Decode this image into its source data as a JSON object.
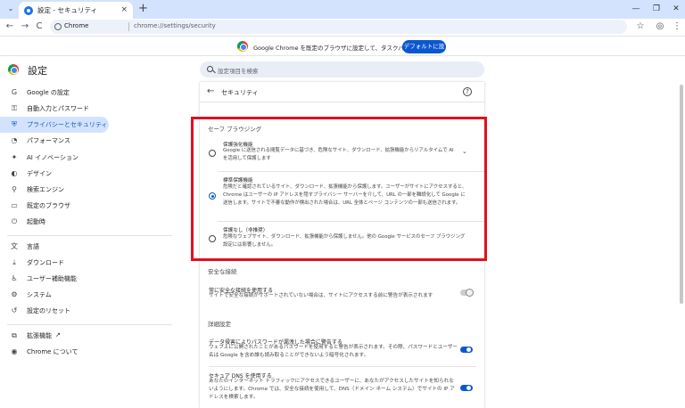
{
  "browser": {
    "tab_title": "設定 - セキュリティ",
    "tab_close": "×",
    "new_tab": "+",
    "tab_search": "⌄",
    "window_controls": {
      "minimize": "—",
      "restore": "❐",
      "close": "✕"
    },
    "nav": {
      "back": "←",
      "forward": "→",
      "reload": "C"
    },
    "omnibox": {
      "chip": "Chrome",
      "url": "chrome://settings/security"
    },
    "bookmark_star": "☆",
    "profile": "◎",
    "menu": "⋮"
  },
  "infobar": {
    "message": "Google Chrome を既定のブラウザに設定して、タスクバーに固定する",
    "button": "デフォルトに設定"
  },
  "settings_header": {
    "title": "設定",
    "search_placeholder": "設定項目を検索"
  },
  "sidebar": {
    "items": [
      {
        "label": "Google の設定",
        "icon": "G"
      },
      {
        "label": "自動入力とパスワード",
        "icon": "⚿"
      },
      {
        "label": "プライバシーとセキュリティ",
        "icon": "⛨"
      },
      {
        "label": "パフォーマンス",
        "icon": "◔"
      },
      {
        "label": "AI イノベーション",
        "icon": "✦"
      },
      {
        "label": "デザイン",
        "icon": "◐"
      },
      {
        "label": "検索エンジン",
        "icon": "⚲"
      },
      {
        "label": "既定のブラウザ",
        "icon": "▭"
      },
      {
        "label": "起動時",
        "icon": "⏻"
      },
      {
        "label": "言語",
        "icon": "文"
      },
      {
        "label": "ダウンロード",
        "icon": "⤓"
      },
      {
        "label": "ユーザー補助機能",
        "icon": "♿"
      },
      {
        "label": "システム",
        "icon": "⚙"
      },
      {
        "label": "設定のリセット",
        "icon": "↺"
      },
      {
        "label": "拡張機能",
        "icon": "⧉",
        "external": "↗"
      },
      {
        "label": "Chrome について",
        "icon": "◉"
      }
    ]
  },
  "panel": {
    "back": "←",
    "title": "セキュリティ",
    "help": "?",
    "safe_browsing_heading": "セーフ ブラウジング",
    "options": [
      {
        "title": "保護強化機能",
        "desc": "Google に送信される閲覧データに基づき、危険なサイト、ダウンロード、拡張機能からリアルタイムで AI を活用して保護します",
        "checked": false,
        "expand": "⌄"
      },
      {
        "title": "標準保護機能",
        "desc": "危険だと確認されているサイト、ダウンロード、拡張機能から保護します。ユーザーがサイトにアクセスすると、Chrome はユーザーの IP アドレスを隠すプライバシー サーバーを介して、URL の一部を難読化して Google に送信します。サイトで不審な動作が検出された場合は、URL 全体とページ コンテンツの一部も送信されます。",
        "checked": true
      },
      {
        "title": "保護なし（非推奨）",
        "desc": "危険なウェブサイト、ダウンロード、拡張機能から保護しません。他の Google サービスのセーフ ブラウジング設定には影響しません。",
        "checked": false
      }
    ],
    "secure_connections_heading": "安全な接続",
    "always_secure": {
      "title": "常に安全な接続を使用する",
      "desc": "サイトで安全な接続がサポートされていない場合は、サイトにアクセスする前に警告が表示されます",
      "enabled": false
    },
    "advanced_heading": "詳細設定",
    "password_warning": {
      "title": "データ侵害によりパスワードが漏洩した場合に警告する",
      "desc": "ウェブ上に公開されたことがあるパスワードを使用すると警告が表示されます。その際、パスワードとユーザー名は Google を含め誰も読み取ることができないよう暗号化されます。",
      "enabled": true
    },
    "secure_dns": {
      "title": "セキュア DNS を使用する",
      "desc": "あなたのインターネット トラフィックにアクセスできるユーザーに、あなたがアクセスしたサイトを知られないようにします。Chrome では、安全な接続を使用して、DNS（ドメイン ネーム システム）でサイトの IP アドレスを検索します。",
      "enabled": true
    }
  },
  "colors": {
    "highlight": "#e0101e",
    "accent": "#0b57d0",
    "tabstrip": "#d3e3fd"
  }
}
